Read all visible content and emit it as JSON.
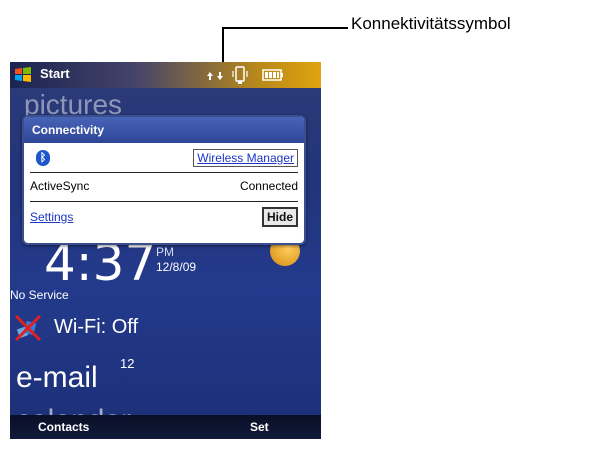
{
  "callout": {
    "label": "Konnektivitätssymbol"
  },
  "topbar": {
    "start_label": "Start",
    "icons": [
      "start-flag-icon",
      "connectivity-icon",
      "phone-vibrate-icon",
      "battery-icon"
    ]
  },
  "background": {
    "pictures_text": "pictures"
  },
  "popup": {
    "title": "Connectivity",
    "bluetooth_icon": "bluetooth-icon",
    "wireless_manager": "Wireless Manager",
    "activesync_label": "ActiveSync",
    "activesync_status": "Connected",
    "settings": "Settings",
    "hide": "Hide"
  },
  "clock": {
    "time": "4:37",
    "ampm": "PM",
    "date": "12/8/09",
    "service": "No Service"
  },
  "tiles": {
    "wifi": "Wi-Fi: Off",
    "email": "e-mail",
    "email_count": "12",
    "calendar": "calendar"
  },
  "softkeys": {
    "left": "Contacts",
    "right": "Set"
  },
  "colors": {
    "title_bar": "#2e4597",
    "link": "#1b35c4",
    "accent": "#e0a310"
  }
}
